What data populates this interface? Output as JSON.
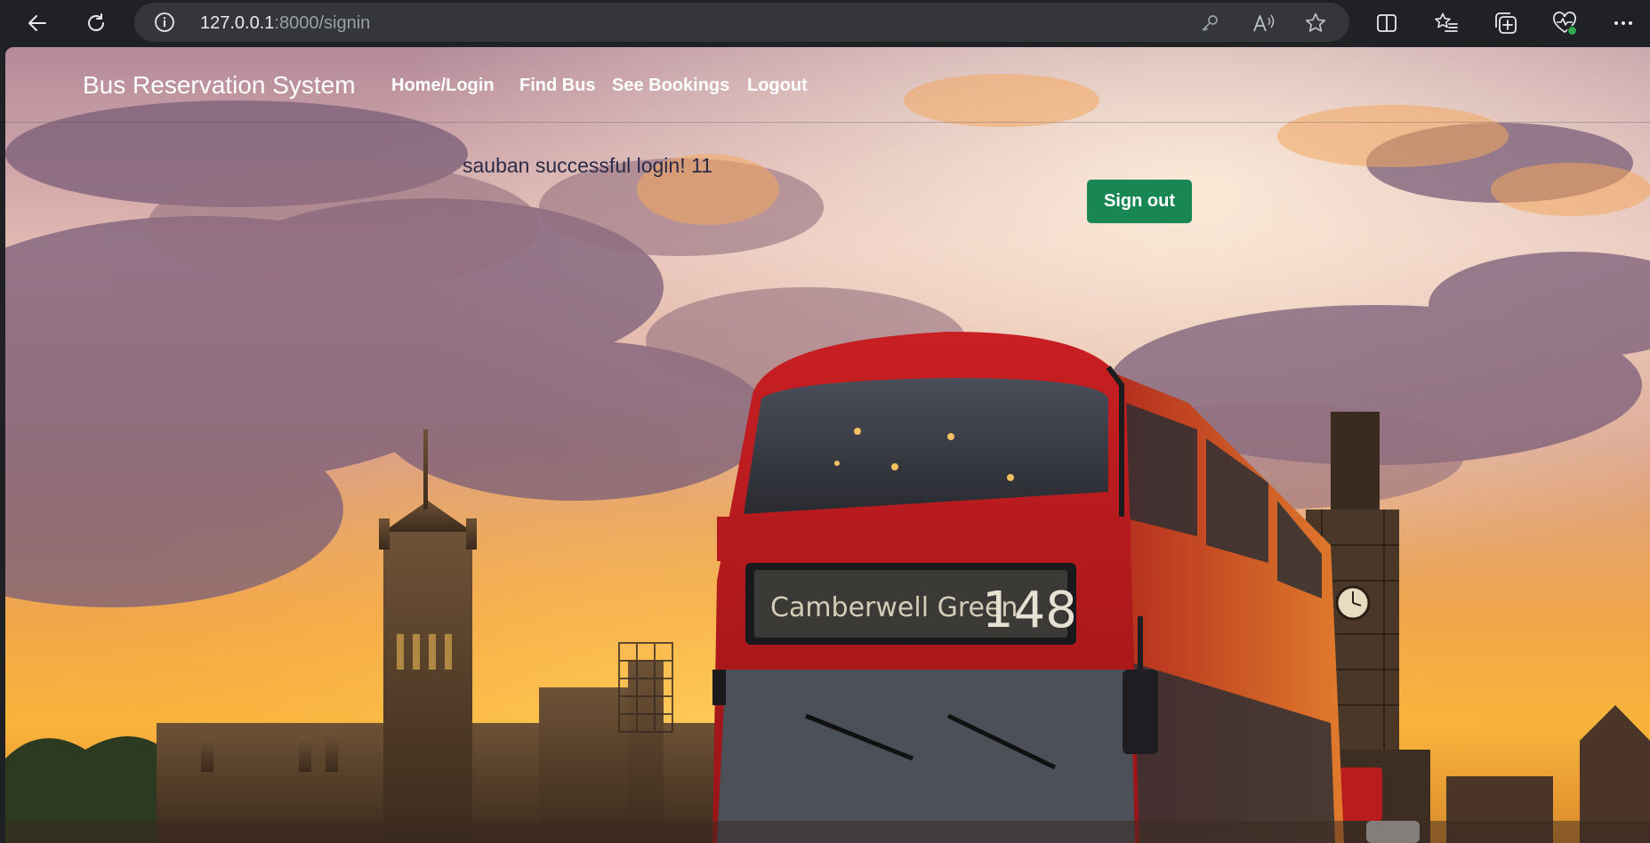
{
  "browser": {
    "url_host": "127.0.0.1",
    "url_path": ":8000/signin"
  },
  "navbar": {
    "brand": "Bus Reservation System",
    "links": [
      "Home/Login",
      "Find Bus",
      "See Bookings",
      "Logout"
    ]
  },
  "main": {
    "welcome_message": "sauban successful login! 11",
    "signout_label": "Sign out"
  },
  "background": {
    "bus_destination": "Camberwell Green",
    "bus_route": "148"
  },
  "icons": {
    "back": "back-arrow-icon",
    "refresh": "refresh-icon",
    "site_info": "info-icon",
    "password": "key-icon",
    "read_aloud": "read-aloud-icon",
    "favorite": "star-icon",
    "split_screen": "split-screen-icon",
    "favorites": "favorites-icon",
    "collections": "collections-icon",
    "health": "browser-essentials-icon",
    "menu": "more-icon"
  },
  "colors": {
    "signout_button": "#198754",
    "browser_frame": "#202124",
    "address_bar": "#35363a"
  }
}
